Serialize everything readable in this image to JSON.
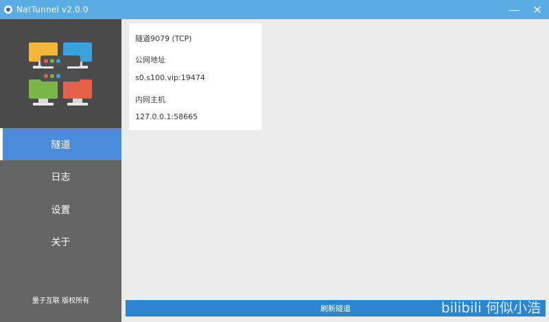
{
  "window": {
    "title": "NatTunnel v2.0.0",
    "minimize_glyph": "—",
    "close_glyph": "✕"
  },
  "sidebar": {
    "items": [
      {
        "label": "隧道",
        "active": true
      },
      {
        "label": "日志",
        "active": false
      },
      {
        "label": "设置",
        "active": false
      },
      {
        "label": "关于",
        "active": false
      }
    ],
    "footer": "量子互联 版权所有"
  },
  "tunnel_card": {
    "name": "隧道9079 (TCP)",
    "public_label": "公网地址",
    "public_value": "s0.s100.vip:19474",
    "local_label": "内网主机",
    "local_value": "127.0.0.1:58665"
  },
  "refresh_button": "刷新隧道",
  "watermark": "bilibili 何似小浩",
  "colors": {
    "titlebar": "#5aace4",
    "sidebar": "#656565",
    "logo_bg": "#4a4a4a",
    "active_nav": "#4a8bdb",
    "refresh_button": "#2b86cf"
  }
}
